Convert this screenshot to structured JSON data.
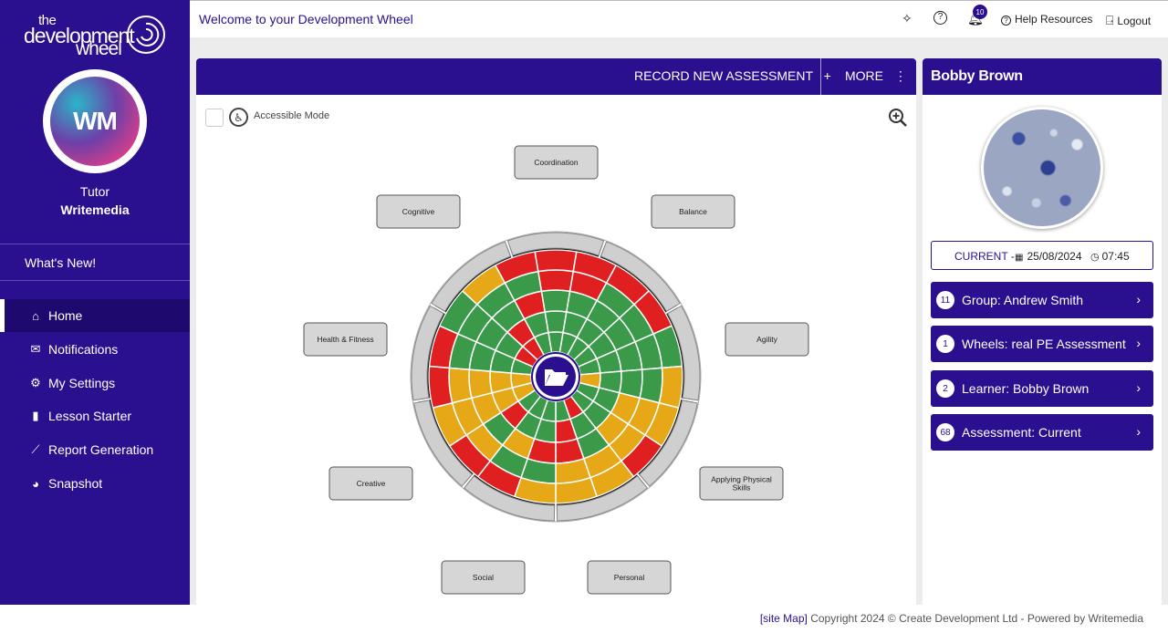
{
  "brand": {
    "line1": "the",
    "line2": "development",
    "line3": "wheel"
  },
  "user": {
    "initials": "WM",
    "role": "Tutor",
    "name": "Writemedia"
  },
  "sidebar": {
    "whats_new": "What's New!",
    "items": [
      {
        "label": "Home",
        "icon": "home-icon",
        "active": true
      },
      {
        "label": "Notifications",
        "icon": "bell-icon"
      },
      {
        "label": "My Settings",
        "icon": "user-settings-icon"
      },
      {
        "label": "Lesson Starter",
        "icon": "book-icon"
      },
      {
        "label": "Report Generation",
        "icon": "chart-icon"
      },
      {
        "label": "Snapshot",
        "icon": "pie-icon"
      }
    ]
  },
  "topbar": {
    "title": "Welcome to your Development Wheel",
    "notification_count": "10",
    "help": "Help Resources",
    "logout": "Logout"
  },
  "panel": {
    "record": "RECORD NEW ASSESSMENT",
    "more": "MORE",
    "accessible": "Accessible Mode"
  },
  "wheel": {
    "labels": [
      "Coordination",
      "Balance",
      "Agility",
      "Applying Physical Skills",
      "Personal",
      "Social",
      "Creative",
      "Health & Fitness",
      "Cognitive"
    ],
    "colors": {
      "red": "#e02020",
      "green": "#3a9a4a",
      "amber": "#e6a817",
      "grey": "#cfcfcf"
    },
    "segments": [
      [
        "g",
        "g",
        "g",
        "r",
        "r"
      ],
      [
        "g",
        "g",
        "g",
        "r",
        "r"
      ],
      [
        "g",
        "g",
        "g",
        "g",
        "r"
      ],
      [
        "g",
        "g",
        "g",
        "g",
        "r"
      ],
      [
        "g",
        "g",
        "g",
        "g",
        "g"
      ],
      [
        "a",
        "g",
        "g",
        "g",
        "a"
      ],
      [
        "g",
        "g",
        "a",
        "a",
        "a"
      ],
      [
        "g",
        "g",
        "a",
        "a",
        "r"
      ],
      [
        "r",
        "g",
        "g",
        "a",
        "a"
      ],
      [
        "g",
        "r",
        "r",
        "a",
        "a"
      ],
      [
        "g",
        "g",
        "r",
        "g",
        "a"
      ],
      [
        "g",
        "g",
        "a",
        "g",
        "r"
      ],
      [
        "g",
        "r",
        "g",
        "a",
        "r"
      ],
      [
        "a",
        "a",
        "a",
        "a",
        "a"
      ],
      [
        "a",
        "a",
        "a",
        "a",
        "r"
      ],
      [
        "g",
        "g",
        "g",
        "g",
        "r"
      ],
      [
        "r",
        "g",
        "g",
        "g",
        "g"
      ],
      [
        "r",
        "r",
        "g",
        "g",
        "a"
      ],
      [
        "g",
        "g",
        "r",
        "g",
        "r"
      ]
    ]
  },
  "learner": {
    "name": "Bobby Brown",
    "current_label": "CURRENT -",
    "date": "25/08/2024",
    "time": "07:45",
    "links": [
      {
        "count": "11",
        "label": "Group: Andrew Smith"
      },
      {
        "count": "1",
        "label": "Wheels: real PE Assessment"
      },
      {
        "count": "2",
        "label": "Learner: Bobby Brown"
      },
      {
        "count": "68",
        "label": "Assessment: Current"
      }
    ]
  },
  "footer": {
    "sitemap": "[site Map]",
    "copyright": "Copyright 2024 © Create Development Ltd - Powered by Writemedia"
  }
}
